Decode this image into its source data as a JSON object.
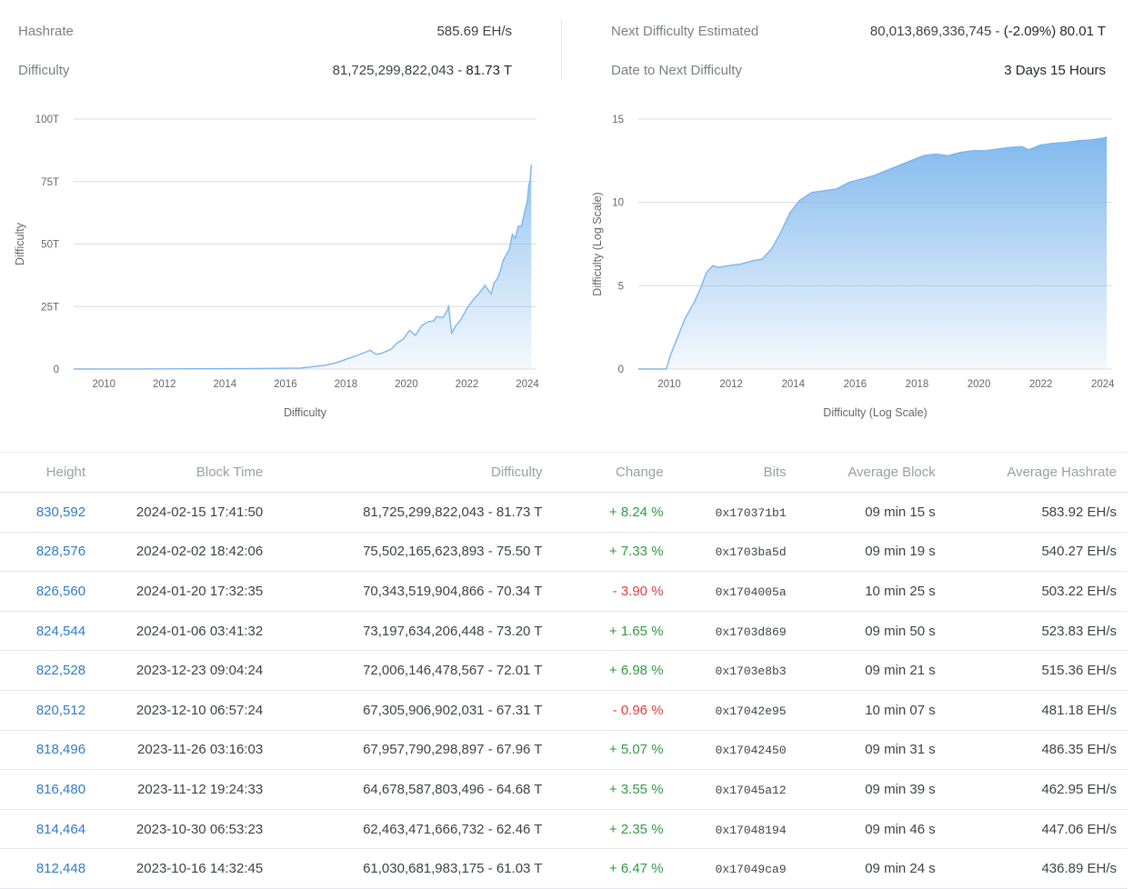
{
  "stats": {
    "hashrate_label": "Hashrate",
    "hashrate_value": "585.69 EH/s",
    "difficulty_label": "Difficulty",
    "difficulty_value": "81,725,299,822,043",
    "difficulty_short": "81.73 T",
    "next_difficulty_label": "Next Difficulty Estimated",
    "next_difficulty_value": "80,013,869,336,745",
    "next_difficulty_change": "(-2.09%) 80.01 T",
    "date_next_label": "Date to Next Difficulty",
    "date_next_value": "3 Days 15 Hours"
  },
  "chart_data": [
    {
      "type": "area",
      "title": "",
      "xlabel": "Difficulty",
      "ylabel": "Difficulty",
      "x_ticks": [
        "2010",
        "2012",
        "2014",
        "2016",
        "2018",
        "2020",
        "2022",
        "2024"
      ],
      "y_ticks": [
        "0",
        "25T",
        "50T",
        "75T",
        "100T"
      ],
      "xlim": [
        2009.0,
        2024.3
      ],
      "ylim": [
        0,
        100
      ],
      "y_unit": "T",
      "grid": true,
      "color": "#7cb5ec",
      "x": [
        2009.0,
        2011.0,
        2013.0,
        2015.0,
        2016.5,
        2017.3,
        2017.7,
        2018.0,
        2018.4,
        2018.8,
        2019.0,
        2019.2,
        2019.5,
        2019.7,
        2019.9,
        2020.1,
        2020.3,
        2020.5,
        2020.7,
        2020.9,
        2021.0,
        2021.2,
        2021.3,
        2021.4,
        2021.45,
        2021.5,
        2021.55,
        2021.6,
        2021.8,
        2022.0,
        2022.2,
        2022.4,
        2022.6,
        2022.8,
        2022.9,
        2023.0,
        2023.1,
        2023.2,
        2023.4,
        2023.5,
        2023.6,
        2023.7,
        2023.8,
        2023.9,
        2024.0,
        2024.04,
        2024.09,
        2024.13
      ],
      "y": [
        0,
        0.02,
        0.1,
        0.2,
        0.4,
        1.5,
        2.6,
        3.9,
        5.6,
        7.5,
        5.9,
        6.4,
        8.0,
        10.5,
        12.0,
        15.5,
        13.5,
        17.3,
        18.9,
        19.2,
        21.0,
        20.6,
        22.2,
        25.0,
        19.0,
        14.4,
        15.5,
        16.8,
        19.8,
        24.3,
        27.6,
        30.3,
        33.5,
        30.0,
        34.6,
        36.0,
        39.1,
        43.5,
        47.9,
        53.9,
        52.4,
        57.1,
        57.1,
        62.5,
        67.3,
        73.2,
        75.5,
        81.73
      ]
    },
    {
      "type": "area",
      "title": "",
      "xlabel": "Difficulty (Log Scale)",
      "ylabel": "Difficulty (Log Scale)",
      "x_ticks": [
        "2010",
        "2012",
        "2014",
        "2016",
        "2018",
        "2020",
        "2022",
        "2024"
      ],
      "y_ticks": [
        "0",
        "5",
        "10",
        "15"
      ],
      "xlim": [
        2009.0,
        2024.3
      ],
      "ylim": [
        0,
        15
      ],
      "grid": true,
      "color": "#7cb5ec",
      "x": [
        2009.0,
        2009.9,
        2010.05,
        2010.2,
        2010.5,
        2010.8,
        2011.0,
        2011.2,
        2011.4,
        2011.6,
        2011.9,
        2012.3,
        2012.7,
        2013.0,
        2013.3,
        2013.6,
        2013.9,
        2014.2,
        2014.6,
        2015.0,
        2015.4,
        2015.8,
        2016.2,
        2016.6,
        2017.0,
        2017.4,
        2017.8,
        2018.2,
        2018.6,
        2019.0,
        2019.4,
        2019.8,
        2020.2,
        2020.6,
        2021.0,
        2021.4,
        2021.6,
        2022.0,
        2022.4,
        2022.8,
        2023.2,
        2023.6,
        2024.0,
        2024.13
      ],
      "y": [
        0,
        0,
        0.9,
        1.6,
        3.0,
        4.0,
        4.8,
        5.8,
        6.2,
        6.1,
        6.2,
        6.3,
        6.5,
        6.6,
        7.2,
        8.2,
        9.4,
        10.1,
        10.6,
        10.7,
        10.8,
        11.2,
        11.4,
        11.6,
        11.9,
        12.2,
        12.5,
        12.8,
        12.9,
        12.8,
        13.0,
        13.1,
        13.1,
        13.2,
        13.3,
        13.35,
        13.15,
        13.45,
        13.55,
        13.6,
        13.7,
        13.75,
        13.85,
        13.92
      ]
    }
  ],
  "table": {
    "headers": [
      "Height",
      "Block Time",
      "Difficulty",
      "Change",
      "Bits",
      "Average Block",
      "Average Hashrate"
    ],
    "rows": [
      [
        "830,592",
        "2024-02-15 17:41:50",
        "81,725,299,822,043 - 81.73 T",
        "+ 8.24 %",
        "0x170371b1",
        "09 min 15 s",
        "583.92 EH/s"
      ],
      [
        "828,576",
        "2024-02-02 18:42:06",
        "75,502,165,623,893 - 75.50 T",
        "+ 7.33 %",
        "0x1703ba5d",
        "09 min 19 s",
        "540.27 EH/s"
      ],
      [
        "826,560",
        "2024-01-20 17:32:35",
        "70,343,519,904,866 - 70.34 T",
        "- 3.90 %",
        "0x1704005a",
        "10 min 25 s",
        "503.22 EH/s"
      ],
      [
        "824,544",
        "2024-01-06 03:41:32",
        "73,197,634,206,448 - 73.20 T",
        "+ 1.65 %",
        "0x1703d869",
        "09 min 50 s",
        "523.83 EH/s"
      ],
      [
        "822,528",
        "2023-12-23 09:04:24",
        "72,006,146,478,567 - 72.01 T",
        "+ 6.98 %",
        "0x1703e8b3",
        "09 min 21 s",
        "515.36 EH/s"
      ],
      [
        "820,512",
        "2023-12-10 06:57:24",
        "67,305,906,902,031 - 67.31 T",
        "- 0.96 %",
        "0x17042e95",
        "10 min 07 s",
        "481.18 EH/s"
      ],
      [
        "818,496",
        "2023-11-26 03:16:03",
        "67,957,790,298,897 - 67.96 T",
        "+ 5.07 %",
        "0x17042450",
        "09 min 31 s",
        "486.35 EH/s"
      ],
      [
        "816,480",
        "2023-11-12 19:24:33",
        "64,678,587,803,496 - 64.68 T",
        "+ 3.55 %",
        "0x17045a12",
        "09 min 39 s",
        "462.95 EH/s"
      ],
      [
        "814,464",
        "2023-10-30 06:53:23",
        "62,463,471,666,732 - 62.46 T",
        "+ 2.35 %",
        "0x17048194",
        "09 min 46 s",
        "447.06 EH/s"
      ],
      [
        "812,448",
        "2023-10-16 14:32:45",
        "61,030,681,983,175 - 61.03 T",
        "+ 6.47 %",
        "0x17049ca9",
        "09 min 24 s",
        "436.89 EH/s"
      ]
    ]
  },
  "colors": {
    "link": "#2f7bc7",
    "positive": "#2e9a43",
    "negative": "#e23b3b",
    "series": "#7cb5ec"
  }
}
